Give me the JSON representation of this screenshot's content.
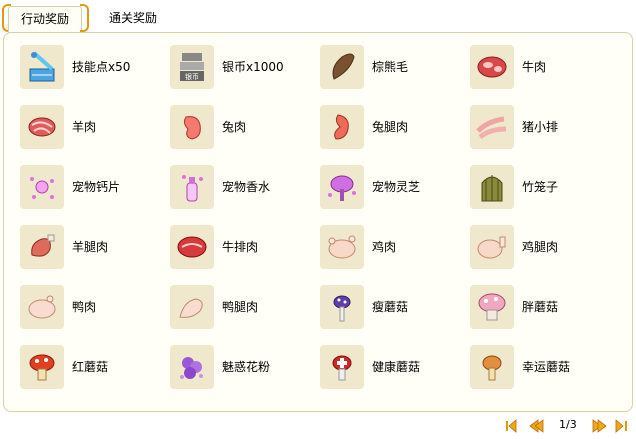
{
  "tabs": [
    {
      "label": "行动奖励",
      "active": true
    },
    {
      "label": "通关奖励",
      "active": false
    }
  ],
  "colors": {
    "accent": "#e09a10",
    "panel_bg": "#fffef7",
    "icon_bg": "#f0e8cc"
  },
  "items": [
    {
      "label": "技能点x50",
      "icon": "skill-point-book-icon"
    },
    {
      "label": "银币x1000",
      "icon": "silver-coin-stack-icon"
    },
    {
      "label": "棕熊毛",
      "icon": "brown-fur-icon"
    },
    {
      "label": "牛肉",
      "icon": "beef-icon"
    },
    {
      "label": "羊肉",
      "icon": "mutton-icon"
    },
    {
      "label": "兔肉",
      "icon": "rabbit-meat-icon"
    },
    {
      "label": "兔腿肉",
      "icon": "rabbit-leg-icon"
    },
    {
      "label": "猪小排",
      "icon": "pork-ribs-icon"
    },
    {
      "label": "宠物钙片",
      "icon": "pet-calcium-icon"
    },
    {
      "label": "宠物香水",
      "icon": "pet-perfume-icon"
    },
    {
      "label": "宠物灵芝",
      "icon": "pet-lingzhi-icon"
    },
    {
      "label": "竹笼子",
      "icon": "bamboo-cage-icon"
    },
    {
      "label": "羊腿肉",
      "icon": "lamb-leg-icon"
    },
    {
      "label": "牛排肉",
      "icon": "steak-icon"
    },
    {
      "label": "鸡肉",
      "icon": "chicken-icon"
    },
    {
      "label": "鸡腿肉",
      "icon": "chicken-leg-icon"
    },
    {
      "label": "鸭肉",
      "icon": "duck-icon"
    },
    {
      "label": "鸭腿肉",
      "icon": "duck-leg-icon"
    },
    {
      "label": "瘦蘑菇",
      "icon": "thin-mushroom-icon"
    },
    {
      "label": "胖蘑菇",
      "icon": "fat-mushroom-icon"
    },
    {
      "label": "红蘑菇",
      "icon": "red-mushroom-icon"
    },
    {
      "label": "魅惑花粉",
      "icon": "charm-pollen-icon"
    },
    {
      "label": "健康蘑菇",
      "icon": "health-mushroom-icon"
    },
    {
      "label": "幸运蘑菇",
      "icon": "lucky-mushroom-icon"
    }
  ],
  "pager": {
    "page_text": "1/3",
    "current_page": 1,
    "total_pages": 3
  }
}
